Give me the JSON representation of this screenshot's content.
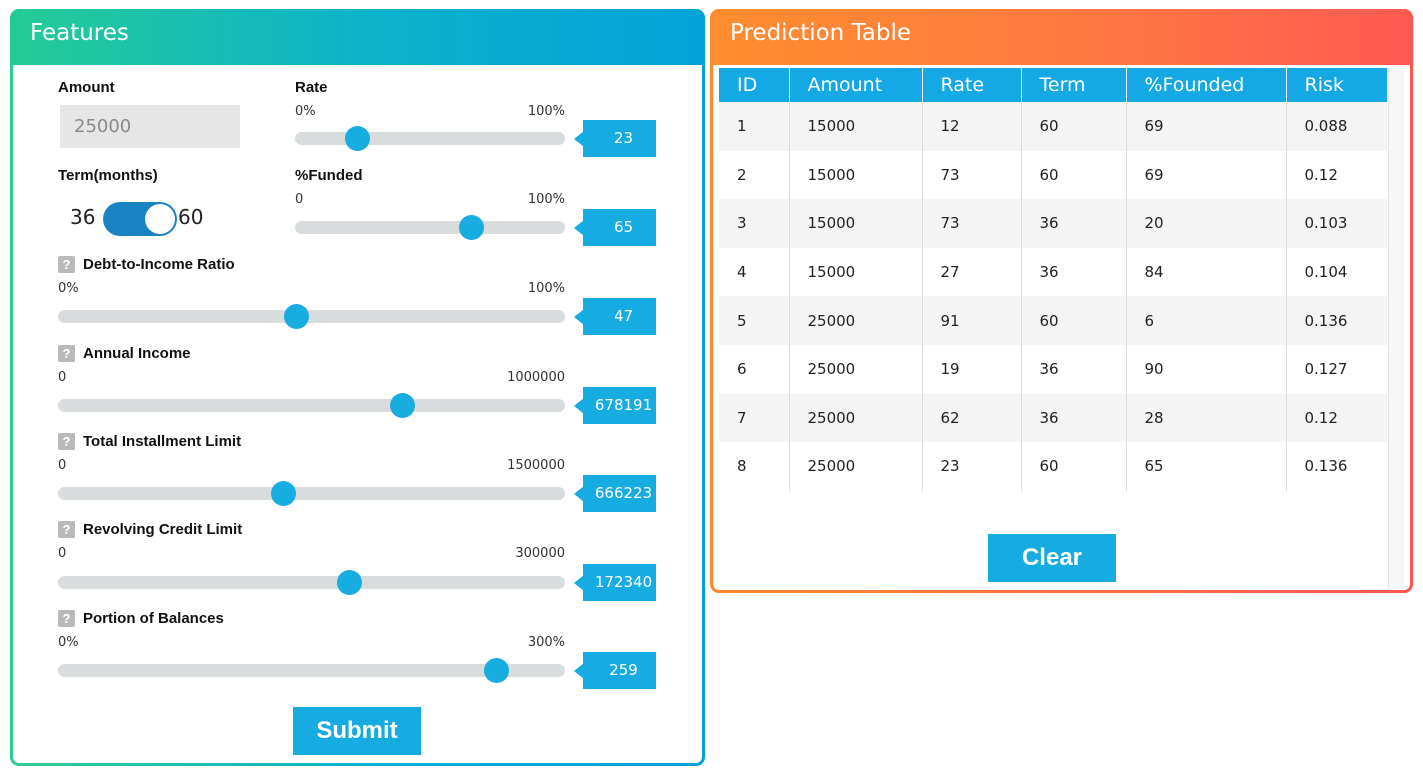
{
  "features": {
    "title": "Features",
    "amount": {
      "label": "Amount",
      "value": "25000"
    },
    "rate": {
      "label": "Rate",
      "min": "0%",
      "max": "100%",
      "value": "23",
      "fraction": 0.23
    },
    "term": {
      "label": "Term(months)",
      "left": "36",
      "right": "60",
      "selected": "60"
    },
    "funded": {
      "label": "%Funded",
      "min": "0",
      "max": "100%",
      "value": "65",
      "fraction": 0.65
    },
    "dti": {
      "help": "?",
      "label": "Debt-to-Income Ratio",
      "min": "0%",
      "max": "100%",
      "value": "47",
      "fraction": 0.47
    },
    "income": {
      "help": "?",
      "label": "Annual Income",
      "min": "0",
      "max": "1000000",
      "value": "678191",
      "fraction": 0.678
    },
    "installment": {
      "help": "?",
      "label": "Total Installment Limit",
      "min": "0",
      "max": "1500000",
      "value": "666223",
      "fraction": 0.444
    },
    "revolving": {
      "help": "?",
      "label": "Revolving Credit Limit",
      "min": "0",
      "max": "300000",
      "value": "172340",
      "fraction": 0.574
    },
    "balances": {
      "help": "?",
      "label": "Portion of Balances",
      "min": "0%",
      "max": "300%",
      "value": "259",
      "fraction": 0.863
    },
    "submit_label": "Submit"
  },
  "prediction": {
    "title": "Prediction Table",
    "headers": [
      "ID",
      "Amount",
      "Rate",
      "Term",
      "%Founded",
      "Risk"
    ],
    "rows": [
      [
        "1",
        "15000",
        "12",
        "60",
        "69",
        "0.088"
      ],
      [
        "2",
        "15000",
        "73",
        "60",
        "69",
        "0.12"
      ],
      [
        "3",
        "15000",
        "73",
        "36",
        "20",
        "0.103"
      ],
      [
        "4",
        "15000",
        "27",
        "36",
        "84",
        "0.104"
      ],
      [
        "5",
        "25000",
        "91",
        "60",
        "6",
        "0.136"
      ],
      [
        "6",
        "25000",
        "19",
        "36",
        "90",
        "0.127"
      ],
      [
        "7",
        "25000",
        "62",
        "36",
        "28",
        "0.12"
      ],
      [
        "8",
        "25000",
        "23",
        "60",
        "65",
        "0.136"
      ]
    ],
    "clear_label": "Clear"
  },
  "colors": {
    "accent": "#16ace2",
    "features_gradient_start": "#25cb95",
    "features_gradient_end": "#03a2d9",
    "prediction_gradient_start": "#ff8d2e",
    "prediction_gradient_end": "#ff5a52",
    "toggle_on": "#1a83c4"
  }
}
